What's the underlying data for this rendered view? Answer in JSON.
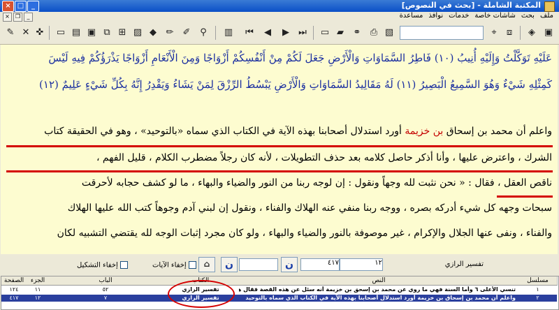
{
  "window": {
    "title": "المكتبة الشاملة - [بحث في النصوص]",
    "controls": {
      "minimize": "_",
      "maximize": "□",
      "close": "×"
    }
  },
  "menu": {
    "items": [
      "ملف",
      "بحث",
      "شاشات خاصة",
      "خدمات",
      "نوافذ",
      "مساعدة"
    ]
  },
  "toolbar": {
    "buttons": [
      "book-open-icon",
      "export-icon",
      "settings-icon",
      "list-icon",
      "cut-icon",
      "paste-icon",
      "ruler-icon",
      "paint-icon",
      "pen-icon",
      "find-icon",
      "first-icon",
      "prev-icon",
      "next-icon",
      "last-icon",
      "print-icon",
      "folder-icon",
      "binoculars-icon",
      "copy-icon",
      "tools-icon",
      "pin-icon",
      "window-icon",
      "wrench-icon",
      "new-doc-icon",
      "help-icon"
    ]
  },
  "text": {
    "quran_line1": "عَلَيْهِ تَوَكَّلْتُ وَإِلَيْهِ أُنِيبُ (١٠) فَاطِرُ السَّمَاوَاتِ وَالْأَرْضِ جَعَلَ لَكُمْ مِنْ أَنْفُسِكُمْ أَزْوَاجًا وَمِنَ الْأَنْعَامِ أَزْوَاجًا يَذْرَؤُكُمْ فِيهِ لَيْسَ",
    "quran_line2": "كَمِثْلِهِ شَيْءٌ وَهُوَ السَّمِيعُ الْبَصِيرُ (١١) لَهُ مَقَالِيدُ السَّمَاوَاتِ وَالْأَرْضِ يَبْسُطُ الرِّزْقَ لِمَنْ يَشَاءُ وَيَقْدِرُ إِنَّهُ بِكُلِّ شَيْءٍ عَلِيمٌ (١٢)",
    "p1_start": "واعلم أن محمد بن إسحاق",
    "p1_name": "بن خزيمة",
    "p1_rest": "أورد استدلال أصحابنا بهذه الآية في الكتاب الذي سماه «بالتوحيد» ، وهو في الحقيقة كتاب",
    "p2": "الشرك ، واعترض عليها ، وأنا أذكر حاصل كلامه بعد حذف التطويلات ، لأنه كان رجلاً مضطرب الكلام ، قليل الفهم ،",
    "p3": "ناقص العقل ، فقال : « نحن نثبت لله وجهاً ونقول : إن لوجه ربنا من النور والضياء والبهاء ، ما لو كشف حجابه لأحرقت",
    "p4": "سبحات وجهه كل شيء أدركه بصره ، ووجه ربنا منفي عنه الهلاك والفناء ، ونقول إن لبني آدم وجوهاً كتب الله عليها الهلاك",
    "p5": "والفناء ، ونفى عنها الجلال والإكرام ، غير موصوفة بالنور والضياء والبهاء ، ولو كان مجرد إثبات الوجه لله يقتضي التشبيه لكان"
  },
  "search": {
    "book_label": "تفسير الرازي",
    "field_volume": "١٢",
    "field_page": "٤١٧",
    "field_extra": "",
    "refresh1": "ن",
    "refresh2": "ن",
    "hide_verses": "إخفاء الآيات",
    "hide_diacritics": "إخفاء التشكيل"
  },
  "results": {
    "headers": {
      "seq": "مسلسل",
      "text": "النص",
      "book": "الكتاب",
      "chapter": "الباب",
      "volume": "الجزء",
      "page": "الصفحة"
    },
    "rows": [
      {
        "seq": "١",
        "text": "تنسي الأعلى ٦ وأما السنة فهي ما روي عن محمد بن إسحق بن خزيمة أنه سئل عن هذه القصة فقال هذا",
        "book": "تفسير الرازي",
        "chapter": "٥٢",
        "volume": "١١",
        "page": "١٢٤"
      },
      {
        "seq": "٢",
        "text": "واعلم أن محمد بن إسحاق بن خزيمة أورد استدلال أصحابنا بهذه الآية في الكتاب الذي سماه بالتوحيد",
        "book": "تفسير الرازي",
        "chapter": "٧",
        "volume": "١٢",
        "page": "٤١٧"
      }
    ]
  },
  "colors": {
    "quran": "#1b2fa0",
    "highlight_name": "#c40000",
    "annotation": "#d40000",
    "text_bg": "#fdfcd0",
    "selected_row": "#2a3f9e"
  }
}
